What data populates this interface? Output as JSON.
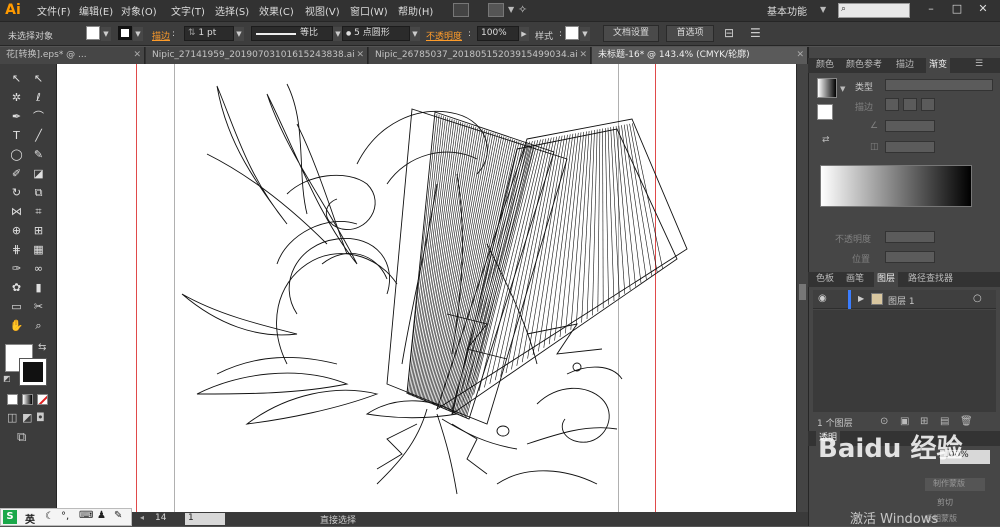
{
  "app": {
    "logo": "Ai"
  },
  "menu": [
    "文件(F)",
    "编辑(E)",
    "对象(O)",
    "文字(T)",
    "选择(S)",
    "效果(C)",
    "视图(V)",
    "窗口(W)",
    "帮助(H)"
  ],
  "workspace": {
    "label": "基本功能",
    "search_placeholder": ""
  },
  "window_controls": {
    "minimize": "–",
    "maximize": "□",
    "close": "✕"
  },
  "control_bar": {
    "selection_status": "未选择对象",
    "stroke_label": "描边",
    "stroke_weight": "1 pt",
    "profile_label": "等比",
    "brush_label": "5 点圆形",
    "opacity_label": "不透明度",
    "opacity_value": "100%",
    "style_label": "样式",
    "doc_settings_button": "文档设置",
    "preferences_button": "首选项"
  },
  "tabs": [
    {
      "label": "花[转换].eps* @ ...",
      "active": false
    },
    {
      "label": "Nipic_27141959_20190703101615243838.ai",
      "active": false
    },
    {
      "label": "Nipic_26785037_20180515203915499034.ai",
      "active": false
    },
    {
      "label": "未标题-16* @ 143.4% (CMYK/轮廓)",
      "active": true
    }
  ],
  "tools": [
    "selection-tool",
    "direct-selection-tool",
    "magic-wand-tool",
    "lasso-tool",
    "pen-tool",
    "curvature-tool",
    "type-tool",
    "line-tool",
    "ellipse-tool",
    "paintbrush-tool",
    "pencil-tool",
    "eraser-tool",
    "rotate-tool",
    "scale-tool",
    "width-tool",
    "free-transform-tool",
    "shape-builder-tool",
    "perspective-tool",
    "mesh-tool",
    "gradient-tool",
    "eyedropper-tool",
    "blend-tool",
    "symbol-sprayer-tool",
    "column-graph-tool",
    "artboard-tool",
    "slice-tool",
    "hand-tool",
    "zoom-tool"
  ],
  "tool_glyphs": [
    "↖",
    "↖",
    "✲",
    "ℓ",
    "✒",
    "⌒",
    "T",
    "╱",
    "◯",
    "✎",
    "✐",
    "◪",
    "↻",
    "⧉",
    "⋈",
    "⌗",
    "⊕",
    "⊞",
    "⋕",
    "▦",
    "✑",
    "∞",
    "✿",
    "▮",
    "▭",
    "✂",
    "✋",
    "⌕"
  ],
  "status_bar": {
    "zoom": "14",
    "page": "1",
    "tool_name": "直接选择"
  },
  "panels": {
    "top_tabs": [
      "颜色",
      "颜色参考",
      "描边",
      "渐变"
    ],
    "gradient": {
      "type_label": "类型",
      "stroke_label": "描边",
      "opacity_label": "不透明度",
      "position_label": "位置"
    },
    "layers_tabs": [
      "色板",
      "画笔",
      "图层",
      "路径查找器"
    ],
    "layers": [
      {
        "name": "图层 1"
      }
    ],
    "layer_count": "1 个图层",
    "appearance_tab": "透明",
    "bottom_value": "100%",
    "bottom_field_1": "制作蒙版",
    "bottom_field_2": "剪切",
    "bottom_field_3": "反相蒙版"
  },
  "ime_bar": {
    "mode": "英",
    "items": [
      "☾",
      "°,",
      "⌨",
      "♟",
      "✎"
    ]
  },
  "watermark": {
    "site": "Baidu 经验",
    "activate_windows": "激活 Windows"
  },
  "colors": {
    "accent_orange": "#ff9c2a",
    "guide_red": "#e04a4a",
    "canvas": "#ffffff",
    "chrome_dark": "#323232"
  }
}
